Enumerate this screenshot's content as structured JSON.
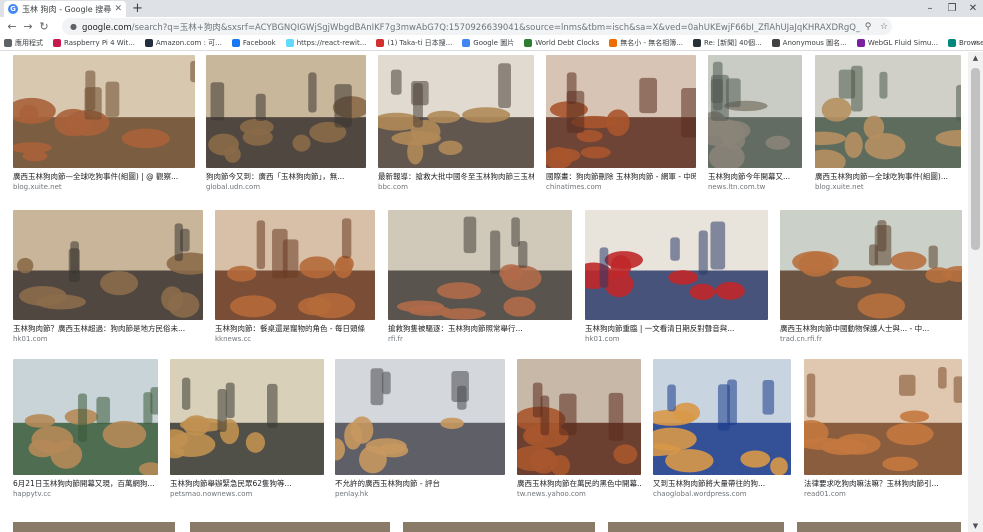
{
  "tab": {
    "title": "玉林 狗肉 - Google 搜尋",
    "favicon": "G"
  },
  "address_bar": {
    "host": "google.com",
    "path": "/search?q=玉林+狗肉&sxsrf=ACYBGNQIGWjSgjWbgdBAnIKF7g3mwAbG7Q:1570926639041&source=lnms&tbm=isch&sa=X&ved=0ahUKEwjF66bI_ZflAhUJaJqKHRAXDRgQ_AUIFigB&biw=1280&bih=592"
  },
  "bookmarks": [
    {
      "label": "應用程式",
      "color": "#5f6368"
    },
    {
      "label": "Raspberry Pi 4 Wit...",
      "color": "#c51a4a"
    },
    {
      "label": "Amazon.com : 可...",
      "color": "#232f3e"
    },
    {
      "label": "Facebook",
      "color": "#1877f2"
    },
    {
      "label": "https://react-rewit...",
      "color": "#61dafb"
    },
    {
      "label": "(1) Taka-ti 日本搜...",
      "color": "#d32f2f"
    },
    {
      "label": "Google 圖片",
      "color": "#4285f4"
    },
    {
      "label": "World Debt Clocks",
      "color": "#2e7d32"
    },
    {
      "label": "無名小 - 無名相簿...",
      "color": "#ef6c00"
    },
    {
      "label": "Re: [新聞] 40個...",
      "color": "#263238"
    },
    {
      "label": "Anonymous 圖名...",
      "color": "#424242"
    },
    {
      "label": "WebGL Fluid Simu...",
      "color": "#7b1fa2"
    },
    {
      "label": "Browse state-of-t...",
      "color": "#00897b"
    }
  ],
  "results": [
    {
      "caption": "廣西玉林狗肉節—全球吃狗事件(組圖) | @ 觀察...",
      "source": "blog.xuite.net",
      "colors": [
        "#6b4a2e",
        "#a9623a",
        "#d8c8b0"
      ]
    },
    {
      "caption": "狗肉節今又到：廣西「玉林狗肉節」，無...",
      "source": "global.udn.com",
      "colors": [
        "#3b3530",
        "#8a6a48",
        "#c9b79c"
      ]
    },
    {
      "caption": "最新報導：搶救大批中國冬至玉林狗肉節三玉林...",
      "source": "bbc.com",
      "colors": [
        "#4a4038",
        "#b08a58",
        "#e0dad0"
      ]
    },
    {
      "caption": "國際畫：狗肉節刪除 玉林狗肉節 - 網軍 - 中時...",
      "source": "chinatimes.com",
      "colors": [
        "#5a2e20",
        "#a8552c",
        "#d8c4b4"
      ]
    },
    {
      "caption": "玉林狗肉節今年開幕又...",
      "source": "news.ltn.com.tw",
      "colors": [
        "#505a52",
        "#8a8478",
        "#c8ccc4"
      ]
    },
    {
      "caption": "廣西玉林狗肉節—全球吃狗事件(組圖)...",
      "source": "blog.xuite.net",
      "colors": [
        "#4a5a4a",
        "#b59060",
        "#d0d0c8"
      ]
    },
    {
      "caption": "玉林狗肉節？廣西玉林超過：狗肉節是地方民俗未...",
      "source": "hk01.com",
      "colors": [
        "#3a3430",
        "#8b6b4a",
        "#c9b59a"
      ]
    },
    {
      "caption": "玉林狗肉節：餐桌還是寵物的角色 - 每日頭條",
      "source": "kknews.cc",
      "colors": [
        "#6a3a22",
        "#b56a3a",
        "#d8c0a8"
      ]
    },
    {
      "caption": "搶救狗隻被驅逐：玉林狗肉節照常舉行...",
      "source": "rfi.fr",
      "colors": [
        "#44403a",
        "#b06a4a",
        "#d0c8b8"
      ]
    },
    {
      "caption": "玉林狗肉節重臨 | 一文看清日期反對聲音與...",
      "source": "hk01.com",
      "colors": [
        "#2a3a6a",
        "#c0282a",
        "#e8e4dc"
      ]
    },
    {
      "caption": "廣西玉林狗肉節中國動物保護人士與... - 中...",
      "source": "trad.cn.rfi.fr",
      "colors": [
        "#5a3e2a",
        "#b8703e",
        "#cbd0c8"
      ]
    },
    {
      "caption": "6月21日玉林狗肉節開幕又現，百萬網狗...",
      "source": "happytv.cc",
      "colors": [
        "#3a5a3a",
        "#b58a58",
        "#c8d4d8"
      ]
    },
    {
      "caption": "玉林狗肉節舉辦緊急民眾62隻狗等...",
      "source": "petsmao.nownews.com",
      "colors": [
        "#3a3a34",
        "#c09050",
        "#d8d0b8"
      ]
    },
    {
      "caption": "不允許的廣西玉林狗肉節 - 評台",
      "source": "penlay.hk",
      "colors": [
        "#4a4a52",
        "#c89860",
        "#d4d8dc"
      ]
    },
    {
      "caption": "廣西玉林狗肉節在萬民的黑色中開幕...",
      "source": "tw.news.yahoo.com",
      "colors": [
        "#5a2a1c",
        "#a8562e",
        "#c8b8a8"
      ]
    },
    {
      "caption": "又到玉林狗肉節將大量帶往的狗...",
      "source": "chaoglobal.wordpress.com",
      "colors": [
        "#1a3a8a",
        "#d89848",
        "#c8d4e0"
      ]
    },
    {
      "caption": "法律要求吃狗肉嘛法嘛？玉林狗肉節引...",
      "source": "read01.com",
      "colors": [
        "#7a4a2a",
        "#c4783e",
        "#e0c8b0"
      ]
    }
  ],
  "icons": {
    "back": "←",
    "forward": "→",
    "reload": "↻",
    "lock": "🔒",
    "search": "🔍",
    "star": "☆",
    "menu": "⋮",
    "account": "☺",
    "scroll_up": "▲",
    "scroll_down": "▼",
    "more": "»"
  }
}
